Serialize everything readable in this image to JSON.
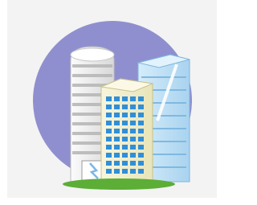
{
  "illustration": {
    "subject": "office-buildings-icon",
    "colors": {
      "panel_background": "#f3f3f3",
      "circle": "#8f8fd0",
      "ground": "#5cae36",
      "white_tower": "#f0f0f0",
      "yellow_tower": "#f2f0cf",
      "blue_tower": "#b5dcf4",
      "window_blue": "#2f8fd8"
    }
  }
}
